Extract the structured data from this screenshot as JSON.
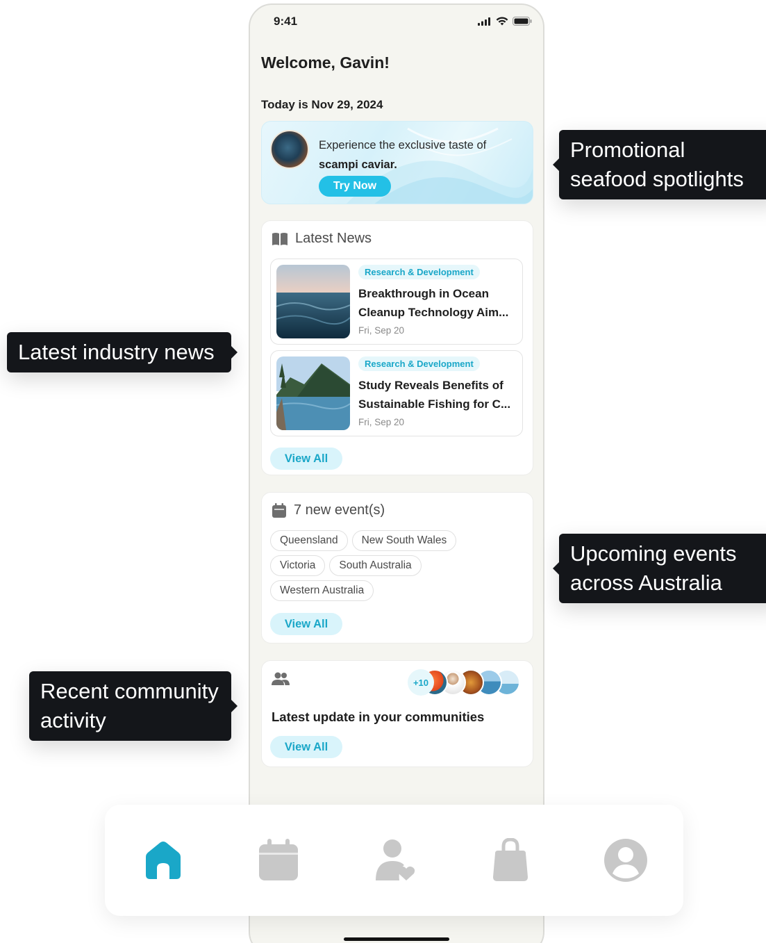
{
  "status_bar": {
    "time": "9:41"
  },
  "greeting": "Welcome, Gavin!",
  "today": "Today is Nov 29, 2024",
  "promo": {
    "line1": "Experience the exclusive taste of",
    "line2": "scampi caviar.",
    "button": "Try Now"
  },
  "news": {
    "heading": "Latest News",
    "items": [
      {
        "tag": "Research & Development",
        "title_line1": "Breakthrough in Ocean",
        "title_line2": "Cleanup Technology Aim...",
        "date": "Fri, Sep 20"
      },
      {
        "tag": "Research & Development",
        "title_line1": "Study Reveals Benefits of",
        "title_line2": "Sustainable Fishing for C...",
        "date": "Fri, Sep 20"
      }
    ],
    "view_all": "View All"
  },
  "events": {
    "heading": "7 new event(s)",
    "chips": [
      "Queensland",
      "New South Wales",
      "Victoria",
      "South Australia",
      "Western Australia"
    ],
    "view_all": "View All"
  },
  "community": {
    "extra_count": "+10",
    "title": "Latest update in your communities",
    "view_all": "View All"
  },
  "nav": {
    "items": [
      "home-icon",
      "calendar-icon",
      "community-icon",
      "shop-icon",
      "profile-icon"
    ],
    "active_color": "#1aa7c8",
    "inactive_color": "#c8c8c8"
  },
  "callouts": {
    "promo": [
      "Promotional",
      "seafood spotlights"
    ],
    "news": [
      "Latest industry news"
    ],
    "events": [
      "Upcoming events",
      "across Australia"
    ],
    "community": [
      "Recent community",
      "activity"
    ]
  },
  "colors": {
    "accent": "#23c0e6",
    "accent_soft": "#d9f4fb",
    "background": "#f5f5f0"
  }
}
